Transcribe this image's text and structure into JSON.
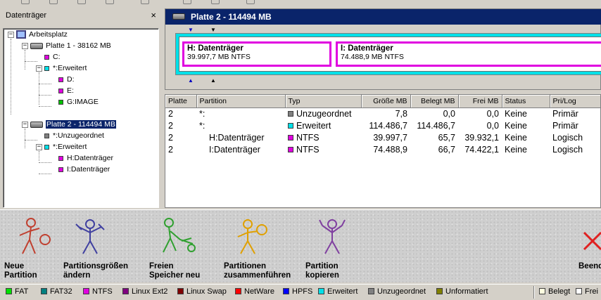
{
  "tree_pane": {
    "title": "Datenträger",
    "close": "×",
    "items": [
      {
        "label": "Arbeitsplatz",
        "kind": "computer"
      },
      {
        "label": "Platte 1 - 38162 MB",
        "kind": "disk"
      },
      {
        "label": "C:",
        "color": "#e000e0"
      },
      {
        "label": "*:Erweitert",
        "color": "#00e0e8"
      },
      {
        "label": "D:",
        "color": "#e000e0"
      },
      {
        "label": "E:",
        "color": "#e000e0"
      },
      {
        "label": "G:IMAGE",
        "color": "#00c000"
      },
      {
        "label": "Platte 2 - 114494 MB",
        "kind": "disk",
        "selected": true
      },
      {
        "label": "*:Unzugeordnet",
        "color": "#808080"
      },
      {
        "label": "*:Erweitert",
        "color": "#00e0e8"
      },
      {
        "label": "H:Datenträger",
        "color": "#e000e0"
      },
      {
        "label": "I:Datenträger",
        "color": "#e000e0"
      }
    ]
  },
  "disk_map": {
    "title": "Platte 2 - 114494 MB",
    "partitions": [
      {
        "name": "H:  Datenträger",
        "info": "39.997,7 MB    NTFS"
      },
      {
        "name": "I:  Datenträger",
        "info": "74.488,9 MB    NTFS"
      }
    ]
  },
  "table": {
    "columns": [
      "Platte",
      "Partition",
      "Typ",
      "Größe MB",
      "Belegt MB",
      "Frei MB",
      "Status",
      "Pri/Log"
    ],
    "rows": [
      {
        "platte": "2",
        "partition": "*:",
        "typ": "Unzugeordnet",
        "typ_color": "#808080",
        "groesse": "7,8",
        "belegt": "0,0",
        "frei": "0,0",
        "status": "Keine",
        "prilog": "Primär"
      },
      {
        "platte": "2",
        "partition": "*:",
        "typ": "Erweitert",
        "typ_color": "#00e0e8",
        "groesse": "114.486,7",
        "belegt": "114.486,7",
        "frei": "0,0",
        "status": "Keine",
        "prilog": "Primär"
      },
      {
        "platte": "2",
        "partition": "H:Datenträger",
        "typ": "NTFS",
        "typ_color": "#e000e0",
        "groesse": "39.997,7",
        "belegt": "65,7",
        "frei": "39.932,1",
        "status": "Keine",
        "prilog": "Logisch"
      },
      {
        "platte": "2",
        "partition": "I:Datenträger",
        "typ": "NTFS",
        "typ_color": "#e000e0",
        "groesse": "74.488,9",
        "belegt": "66,7",
        "frei": "74.422,1",
        "status": "Keine",
        "prilog": "Logisch"
      }
    ]
  },
  "actions": [
    {
      "label": "Neue\nPartition",
      "color": "#c04030"
    },
    {
      "label": "Partitionsgrößen\nändern",
      "color": "#4040a0"
    },
    {
      "label": "Freien\nSpeicher neu",
      "color": "#30a030"
    },
    {
      "label": "Partitionen\nzusammenführen",
      "color": "#e0a000"
    },
    {
      "label": "Partition\nkopieren",
      "color": "#8040a0"
    },
    {
      "label": "Beenden",
      "color": "#e02020"
    }
  ],
  "legend": [
    {
      "label": "FAT",
      "color": "#00e000"
    },
    {
      "label": "FAT32",
      "color": "#008080"
    },
    {
      "label": "NTFS",
      "color": "#e000e0"
    },
    {
      "label": "Linux Ext2",
      "color": "#800080"
    },
    {
      "label": "Linux Swap",
      "color": "#800000"
    },
    {
      "label": "NetWare",
      "color": "#ff0000"
    },
    {
      "label": "HPFS",
      "color": "#0000ff"
    },
    {
      "label": "Erweitert",
      "color": "#00e0e8"
    },
    {
      "label": "Unzugeordnet",
      "color": "#808080"
    },
    {
      "label": "Unformatiert",
      "color": "#808000"
    },
    {
      "label": "Belegt",
      "color": "#ffffe0"
    },
    {
      "label": "Frei",
      "color": "#ffffff"
    }
  ]
}
